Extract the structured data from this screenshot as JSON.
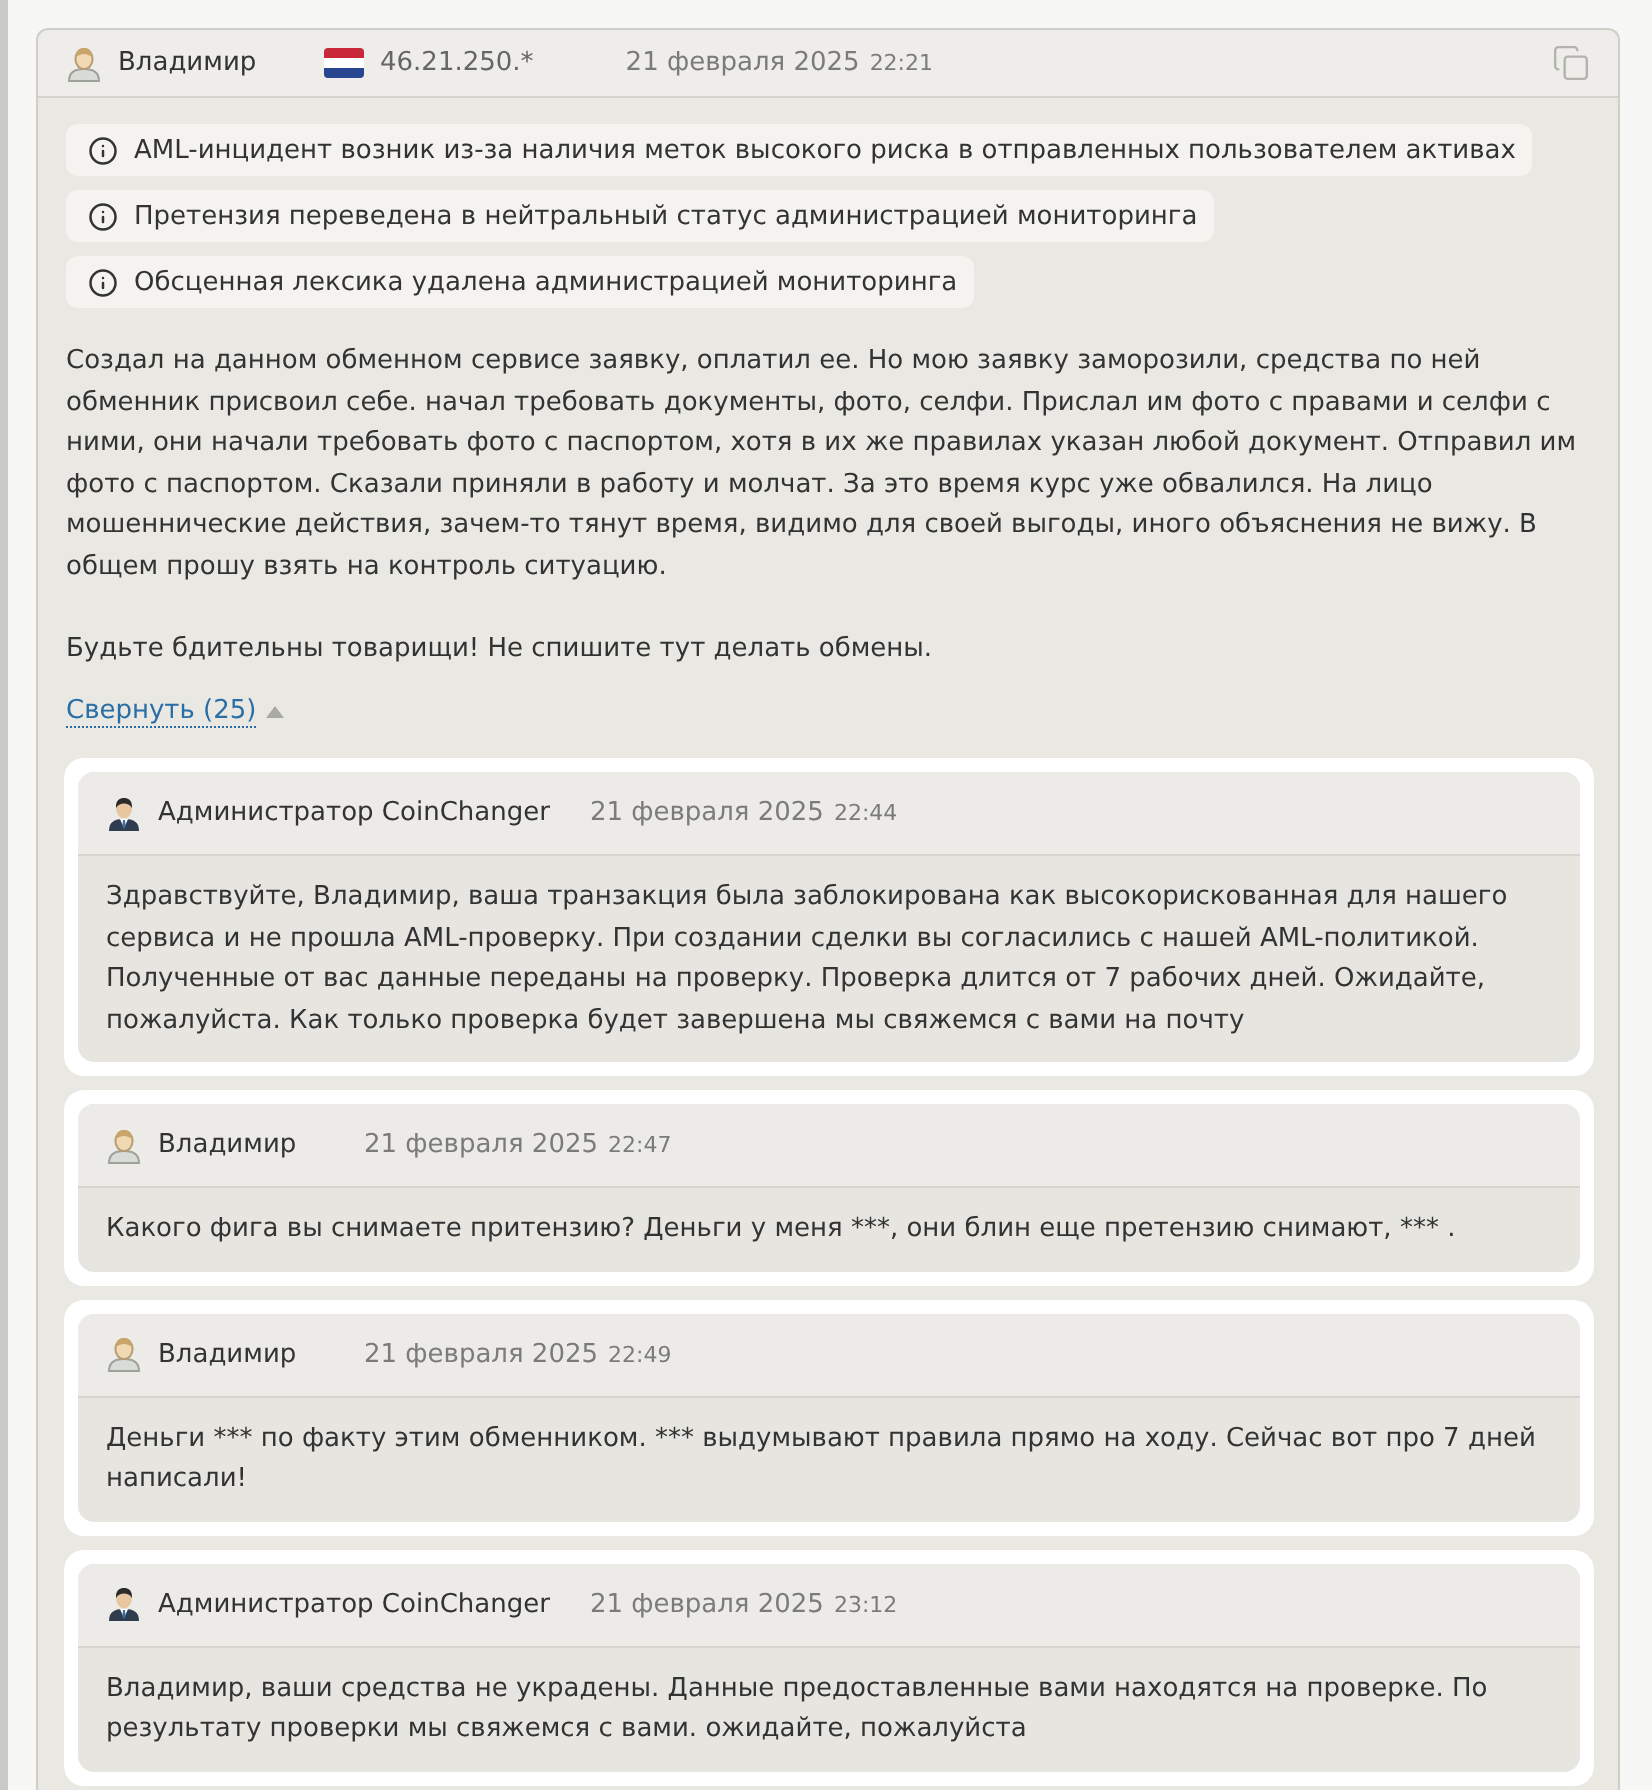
{
  "post": {
    "author": {
      "name": "Владимир",
      "kind": "user"
    },
    "ip": "46.21.250.*",
    "date": "21 февраля 2025",
    "time": "22:21",
    "notices": [
      "AML-инцидент возник из-за наличия меток высокого риска в отправленных пользователем активах",
      "Претензия переведена в нейтральный статус администрацией мониторинга",
      "Обсценная лексика удалена администрацией мониторинга"
    ],
    "paragraphs": [
      "Создал на данном обменном сервисе заявку, оплатил ее. Но мою заявку заморозили, средства по ней обменник присвоил себе. начал требовать документы, фото, селфи. Прислал им фото с правами и селфи с ними, они начали требовать фото с паспортом, хотя в их же правилах указан любой документ. Отправил им фото с паспортом. Сказали приняли в работу и молчат. За это время курс уже обвалился. На лицо мошеннические действия, зачем-то тянут время, видимо для своей выгоды, иного объяснения не вижу. В общем прошу взять на контроль ситуацию.",
      "Будьте бдительны товарищи! Не спишите тут делать обмены."
    ],
    "collapse_link": "Свернуть (25)",
    "expanded": true,
    "replies": [
      {
        "author": {
          "name": "Администратор CoinChanger",
          "kind": "admin"
        },
        "date": "21 февраля 2025",
        "time": "22:44",
        "text": "Здравствуйте, Владимир, ваша транзакция была заблокирована как высокорискованная для нашего сервиса и не прошла AML-проверку. При создании сделки вы согласились с нашей AML-политикой. Полученные от вас данные переданы на проверку. Проверка длится от 7 рабочих дней. Ожидайте, пожалуйста. Как только проверка будет завершена мы свяжемся с вами на почту"
      },
      {
        "author": {
          "name": "Владимир",
          "kind": "user"
        },
        "date": "21 февраля 2025",
        "time": "22:47",
        "text": "Какого фига вы снимаете притензию? Деньги у меня ***, они блин еще претензию снимают, *** ."
      },
      {
        "author": {
          "name": "Владимир",
          "kind": "user"
        },
        "date": "21 февраля 2025",
        "time": "22:49",
        "text": "Деньги *** по факту этим обменником. *** выдумывают правила прямо на ходу. Сейчас вот про 7 дней написали!"
      },
      {
        "author": {
          "name": "Администратор CoinChanger",
          "kind": "admin"
        },
        "date": "21 февраля 2025",
        "time": "23:12",
        "text": "Владимир, ваши средства не украдены. Данные предоставленные вами находятся на проверке. По результату проверки мы свяжемся с вами. ожидайте, пожалуйста"
      }
    ]
  }
}
